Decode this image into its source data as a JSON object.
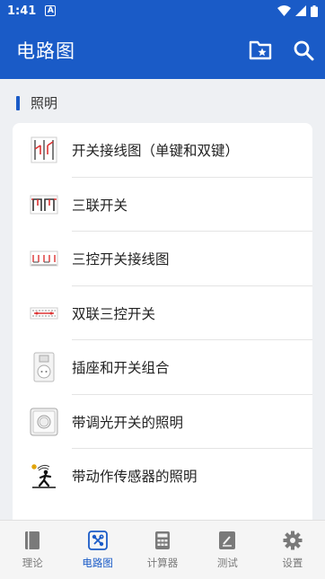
{
  "status": {
    "time": "1:41",
    "notification_glyph": "A"
  },
  "app_bar": {
    "title": "电路图",
    "actions": [
      "folder-star-icon",
      "search-icon"
    ]
  },
  "section": {
    "label": "照明"
  },
  "items": [
    {
      "label": "开关接线图（单键和双键）",
      "icon": "switch-wiring-icon"
    },
    {
      "label": "三联开关",
      "icon": "triple-switch-icon"
    },
    {
      "label": "三控开关接线图",
      "icon": "three-way-switch-icon"
    },
    {
      "label": "双联三控开关",
      "icon": "double-three-control-icon"
    },
    {
      "label": "插座和开关组合",
      "icon": "socket-switch-icon"
    },
    {
      "label": "带调光开关的照明",
      "icon": "dimmer-switch-icon"
    },
    {
      "label": "带动作传感器的照明",
      "icon": "motion-sensor-icon"
    }
  ],
  "bottom_nav": [
    {
      "label": "理论",
      "icon": "book-icon",
      "active": false
    },
    {
      "label": "电路图",
      "icon": "circuit-icon",
      "active": true
    },
    {
      "label": "计算器",
      "icon": "calculator-icon",
      "active": false
    },
    {
      "label": "测试",
      "icon": "test-icon",
      "active": false
    },
    {
      "label": "设置",
      "icon": "gear-icon",
      "active": false
    }
  ],
  "colors": {
    "primary": "#1a5bc7",
    "nav_inactive": "#7a7a7a"
  }
}
